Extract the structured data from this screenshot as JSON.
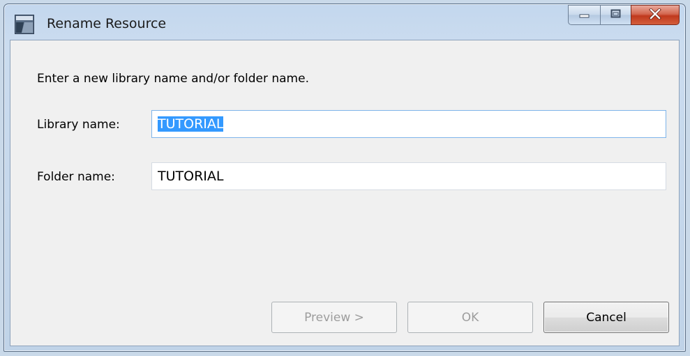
{
  "window": {
    "title": "Rename Resource",
    "icons": {
      "app": "rename-resource-icon",
      "minimize": "minimize-icon",
      "maximize": "maximize-icon",
      "close": "close-icon"
    }
  },
  "dialog": {
    "instruction": "Enter a new library name and/or folder name.",
    "library_label": "Library name:",
    "library_value": "TUTORIAL",
    "library_selected": true,
    "folder_label": "Folder name:",
    "folder_value": "TUTORIAL"
  },
  "buttons": {
    "preview": {
      "label": "Preview >",
      "enabled": false
    },
    "ok": {
      "label": "OK",
      "enabled": false
    },
    "cancel": {
      "label": "Cancel",
      "enabled": true
    }
  },
  "colors": {
    "selection": "#3399ff",
    "close_button": "#c7432a",
    "disabled_text": "#9d9d9d"
  }
}
